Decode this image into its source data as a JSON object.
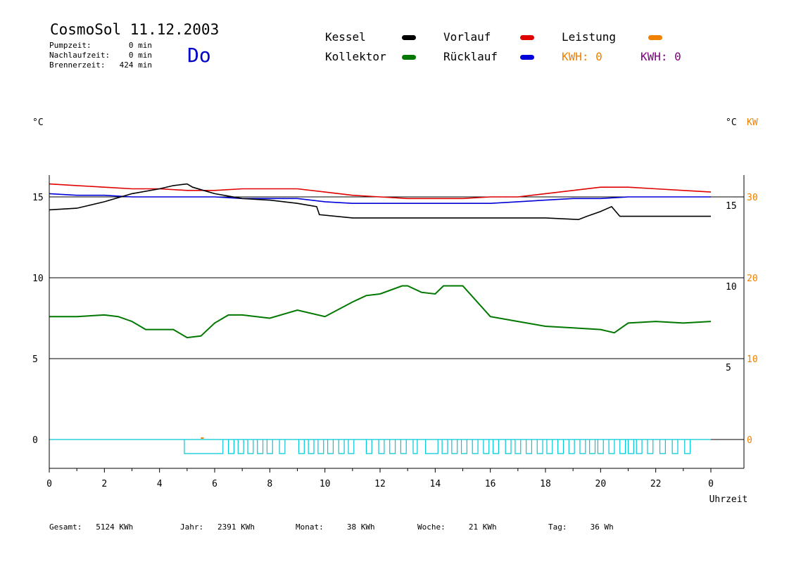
{
  "header": {
    "title": "CosmoSol 11.12.2003",
    "day": "Do",
    "stats": [
      {
        "label": "Pumpzeit:",
        "value": "0 min"
      },
      {
        "label": "Nachlaufzeit:",
        "value": "0 min"
      },
      {
        "label": "Brennerzeit:",
        "value": "424 min"
      }
    ]
  },
  "legend": {
    "kessel": "Kessel",
    "kollektor": "Kollektor",
    "vorlauf": "Vorlauf",
    "ruecklauf": "Rücklauf",
    "leistung": "Leistung",
    "kwh_orange": "KWH: 0",
    "kwh_purple": "KWH: 0"
  },
  "axes": {
    "left_unit": "°C",
    "right_unit_c": "°C",
    "right_unit_kw": "KW",
    "xlabel": "Uhrzeit"
  },
  "footer": [
    {
      "label": "Gesamt:",
      "value": "5124 KWh"
    },
    {
      "label": "Jahr:",
      "value": "2391 KWh"
    },
    {
      "label": "Monat:",
      "value": "38 KWh"
    },
    {
      "label": "Woche:",
      "value": "21 KWh"
    },
    {
      "label": "Tag:",
      "value": "36 Wh"
    }
  ],
  "colors": {
    "kessel": "#000000",
    "kollektor": "#007800",
    "vorlauf": "#e00000",
    "ruecklauf": "#0000d8",
    "leistung": "#f08000",
    "kwh_purple": "#800080",
    "pump": "#00c8d8"
  },
  "chart_data": {
    "type": "line",
    "xlabel": "Uhrzeit",
    "x_ticks": [
      "0",
      "2",
      "4",
      "6",
      "8",
      "10",
      "12",
      "14",
      "16",
      "18",
      "20",
      "22",
      "0"
    ],
    "x_range": [
      0,
      24
    ],
    "y_left_ticks": [
      "0",
      "5",
      "10",
      "15"
    ],
    "y_left_range": [
      -1.8,
      16.8
    ],
    "y_right_inner_ticks": [
      "5",
      "10",
      "15"
    ],
    "y_right_kw_ticks": [
      "0",
      "10",
      "20",
      "30"
    ],
    "grid": "horizontal at 0, 5, 10, 15",
    "series": [
      {
        "name": "Vorlauf",
        "color": "#e00000",
        "x": [
          0,
          1,
          2,
          3,
          4,
          5,
          5.5,
          6,
          7,
          8,
          9,
          10,
          11,
          12,
          13,
          14,
          15,
          16,
          17,
          18,
          19,
          20,
          21,
          22,
          23,
          24
        ],
        "values": [
          15.8,
          15.7,
          15.6,
          15.5,
          15.5,
          15.4,
          15.4,
          15.4,
          15.5,
          15.5,
          15.5,
          15.3,
          15.1,
          15.0,
          14.9,
          14.9,
          14.9,
          15.0,
          15.0,
          15.2,
          15.4,
          15.6,
          15.6,
          15.5,
          15.4,
          15.3
        ]
      },
      {
        "name": "Rücklauf",
        "color": "#0000d8",
        "x": [
          0,
          1,
          2,
          3,
          4,
          5,
          6,
          7,
          8,
          9,
          10,
          11,
          12,
          13,
          14,
          15,
          16,
          17,
          18,
          19,
          20,
          21,
          22,
          23,
          24
        ],
        "values": [
          15.2,
          15.1,
          15.1,
          15.0,
          15.0,
          15.0,
          15.0,
          14.9,
          14.9,
          14.9,
          14.7,
          14.6,
          14.6,
          14.6,
          14.6,
          14.6,
          14.6,
          14.7,
          14.8,
          14.9,
          14.9,
          15.0,
          15.0,
          15.0,
          15.0
        ]
      },
      {
        "name": "Kessel",
        "color": "#000000",
        "x": [
          0,
          1,
          2,
          3,
          4,
          4.5,
          5,
          5.2,
          5.6,
          6,
          7,
          8,
          9,
          9.7,
          9.8,
          11,
          12,
          14,
          16,
          18,
          19.2,
          19.5,
          20,
          20.4,
          20.7,
          22,
          24
        ],
        "values": [
          14.2,
          14.3,
          14.7,
          15.2,
          15.5,
          15.7,
          15.8,
          15.6,
          15.4,
          15.2,
          14.9,
          14.8,
          14.6,
          14.4,
          13.9,
          13.7,
          13.7,
          13.7,
          13.7,
          13.7,
          13.6,
          13.8,
          14.1,
          14.4,
          13.8,
          13.8,
          13.8
        ]
      },
      {
        "name": "Kollektor",
        "color": "#007800",
        "x": [
          0,
          1,
          2,
          2.5,
          3,
          3.5,
          4,
          4.5,
          5,
          5.5,
          6,
          6.5,
          7,
          8,
          9,
          10,
          11,
          11.5,
          12,
          12.8,
          13,
          13.5,
          14,
          14.3,
          15,
          16,
          17,
          18,
          19,
          20,
          20.5,
          21,
          22,
          23,
          24
        ],
        "values": [
          7.6,
          7.6,
          7.7,
          7.6,
          7.3,
          6.8,
          6.8,
          6.8,
          6.3,
          6.4,
          7.2,
          7.7,
          7.7,
          7.5,
          8.0,
          7.6,
          8.5,
          8.9,
          9.0,
          9.5,
          9.5,
          9.1,
          9.0,
          9.5,
          9.5,
          7.6,
          7.3,
          7.0,
          6.9,
          6.8,
          6.6,
          7.2,
          7.3,
          7.2,
          7.3
        ]
      },
      {
        "name": "Leistung",
        "color": "#f08000",
        "x": [
          0,
          24
        ],
        "values": [
          0,
          0
        ]
      }
    ],
    "pump_pulses_hours": [
      [
        4.9,
        6.3
      ],
      [
        6.5,
        6.7
      ],
      [
        6.85,
        7.05
      ],
      [
        7.2,
        7.4
      ],
      [
        7.55,
        7.75
      ],
      [
        7.9,
        8.1
      ],
      [
        8.35,
        8.55
      ],
      [
        9.05,
        9.25
      ],
      [
        9.4,
        9.6
      ],
      [
        9.75,
        9.95
      ],
      [
        10.1,
        10.3
      ],
      [
        10.5,
        10.7
      ],
      [
        10.85,
        11.05
      ],
      [
        11.5,
        11.7
      ],
      [
        11.95,
        12.15
      ],
      [
        12.35,
        12.55
      ],
      [
        12.75,
        12.95
      ],
      [
        13.2,
        13.35
      ],
      [
        13.65,
        14.1
      ],
      [
        14.25,
        14.45
      ],
      [
        14.6,
        14.8
      ],
      [
        14.95,
        15.15
      ],
      [
        15.35,
        15.55
      ],
      [
        15.75,
        15.95
      ],
      [
        16.1,
        16.3
      ],
      [
        16.55,
        16.75
      ],
      [
        16.9,
        17.1
      ],
      [
        17.3,
        17.5
      ],
      [
        17.7,
        17.9
      ],
      [
        18.05,
        18.25
      ],
      [
        18.45,
        18.65
      ],
      [
        18.85,
        19.05
      ],
      [
        19.25,
        19.45
      ],
      [
        19.6,
        19.8
      ],
      [
        19.9,
        20.1
      ],
      [
        20.3,
        20.5
      ],
      [
        20.7,
        20.9
      ],
      [
        21.0,
        21.2
      ],
      [
        21.3,
        21.5
      ],
      [
        21.7,
        21.9
      ],
      [
        22.15,
        22.35
      ],
      [
        22.6,
        22.8
      ],
      [
        23.05,
        23.25
      ]
    ]
  }
}
